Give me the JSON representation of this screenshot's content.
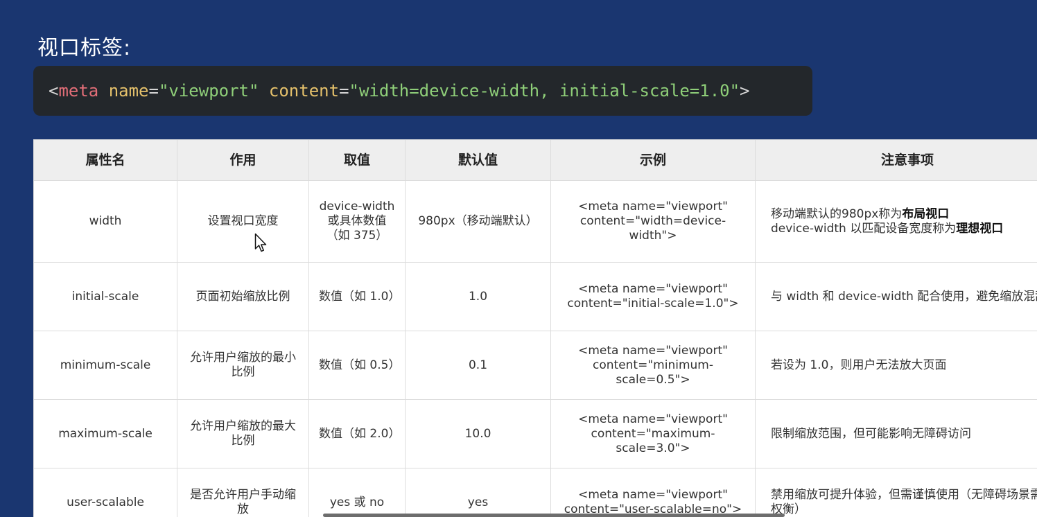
{
  "title": "视口标签:",
  "code": {
    "open": "<",
    "tag": "meta",
    "space1": " ",
    "attr1": "name",
    "eq1": "=",
    "val1": "\"viewport\"",
    "space2": " ",
    "attr2": "content",
    "eq2": "=",
    "val2": "\"width=device-width, initial-scale=1.0\"",
    "close": ">",
    "colors": {
      "background": "#23272b",
      "tag": "#e36e78",
      "attribute": "#e5c16b",
      "string": "#8fcf79",
      "punctuation": "#d6d6d6"
    }
  },
  "table": {
    "headers": [
      "属性名",
      "作用",
      "取值",
      "默认值",
      "示例",
      "注意事项"
    ],
    "rows": [
      {
        "name": "width",
        "purpose": "设置视口宽度",
        "values": "device-width 或具体数值（如 375）",
        "default": "980px（移动端默认）",
        "example": "<meta name=\"viewport\" content=\"width=device-width\">",
        "notes_parts": {
          "p1": "移动端默认的980px称为",
          "b1": "布局视口",
          "p2": "device-width 以匹配设备宽度称为",
          "b2": "理想视口"
        }
      },
      {
        "name": "initial-scale",
        "purpose": "页面初始缩放比例",
        "values": "数值（如 1.0）",
        "default": "1.0",
        "example": "<meta name=\"viewport\" content=\"initial-scale=1.0\">",
        "notes": "与 width 和 device-width 配合使用，避免缩放混乱"
      },
      {
        "name": "minimum-scale",
        "purpose": "允许用户缩放的最小比例",
        "values": "数值（如 0.5）",
        "default": "0.1",
        "example": "<meta name=\"viewport\" content=\"minimum-scale=0.5\">",
        "notes": "若设为 1.0，则用户无法放大页面"
      },
      {
        "name": "maximum-scale",
        "purpose": "允许用户缩放的最大比例",
        "values": "数值（如 2.0）",
        "default": "10.0",
        "example": "<meta name=\"viewport\" content=\"maximum-scale=3.0\">",
        "notes": "限制缩放范围，但可能影响无障碍访问"
      },
      {
        "name": "user-scalable",
        "purpose": "是否允许用户手动缩放",
        "values": "yes 或 no",
        "default": "yes",
        "example": "<meta name=\"viewport\" content=\"user-scalable=no\">",
        "notes": "禁用缩放可提升体验，但需谨慎使用（无障碍场景需权衡）"
      }
    ]
  },
  "icons": {
    "cursor": "mouse-pointer-icon"
  }
}
